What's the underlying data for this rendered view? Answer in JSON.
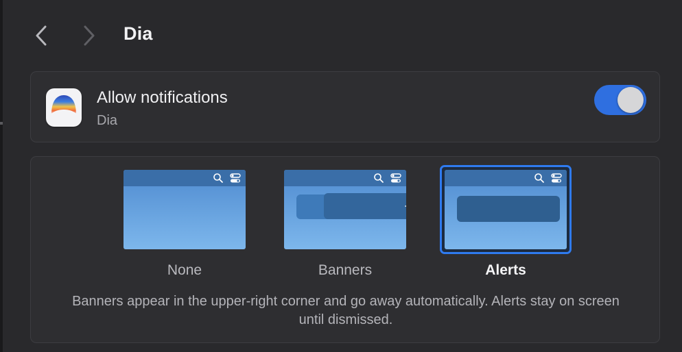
{
  "header": {
    "title": "Dia",
    "back_icon": "chevron-left-icon",
    "forward_icon": "chevron-right-icon"
  },
  "allow": {
    "title": "Allow notifications",
    "app_name": "Dia",
    "toggle_on": true,
    "toggle_color": "#2f6fe0"
  },
  "styles": {
    "options": [
      {
        "label": "None",
        "selected": false
      },
      {
        "label": "Banners",
        "selected": false
      },
      {
        "label": "Alerts",
        "selected": true
      }
    ],
    "selection_color": "#2f7bf0",
    "description": "Banners appear in the upper-right corner and go away automatically. Alerts stay on screen until dismissed."
  }
}
